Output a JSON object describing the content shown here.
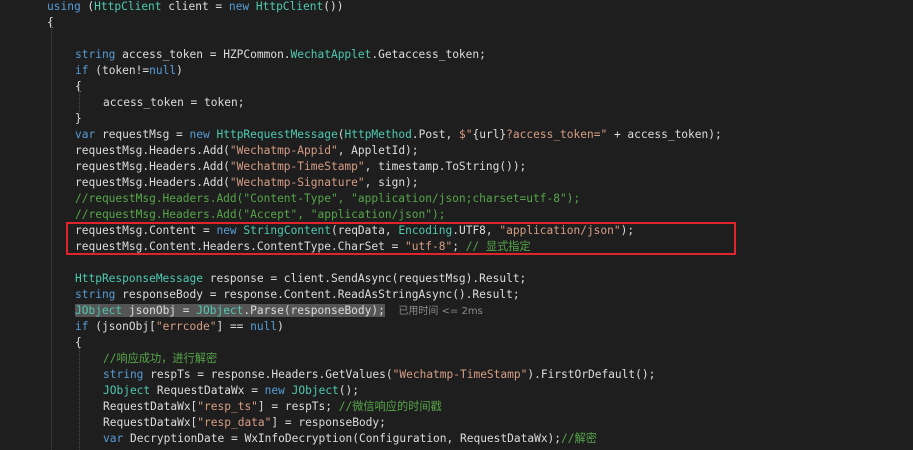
{
  "colors": {
    "background": "#1e1e1e",
    "keyword": "#569cd6",
    "type": "#4ec9b0",
    "string": "#d69d85",
    "comment": "#57a64a",
    "text": "#dcdcdc",
    "highlight_box": "#e0242b"
  },
  "editor": {
    "lines": [
      {
        "indent": 0,
        "tokens": [
          {
            "c": "kw",
            "t": "using"
          },
          {
            "c": "pl",
            "t": " ("
          },
          {
            "c": "ty",
            "t": "HttpClient"
          },
          {
            "c": "pl",
            "t": " client = "
          },
          {
            "c": "kw",
            "t": "new"
          },
          {
            "c": "pl",
            "t": " "
          },
          {
            "c": "ty",
            "t": "HttpClient"
          },
          {
            "c": "pl",
            "t": "())"
          }
        ]
      },
      {
        "indent": 0,
        "tokens": [
          {
            "c": "pl",
            "t": "{"
          }
        ]
      },
      {
        "indent": 1,
        "tokens": []
      },
      {
        "indent": 1,
        "tokens": [
          {
            "c": "kw",
            "t": "string"
          },
          {
            "c": "pl",
            "t": " access_token = HZPCommon."
          },
          {
            "c": "ty",
            "t": "WechatApplet"
          },
          {
            "c": "pl",
            "t": ".Getaccess_token;"
          }
        ]
      },
      {
        "indent": 1,
        "tokens": [
          {
            "c": "kw",
            "t": "if"
          },
          {
            "c": "pl",
            "t": " (token!="
          },
          {
            "c": "kw",
            "t": "null"
          },
          {
            "c": "pl",
            "t": ")"
          }
        ]
      },
      {
        "indent": 1,
        "tokens": [
          {
            "c": "pl",
            "t": "{"
          }
        ]
      },
      {
        "indent": 2,
        "tokens": [
          {
            "c": "pl",
            "t": "access_token = token;"
          }
        ]
      },
      {
        "indent": 1,
        "tokens": [
          {
            "c": "pl",
            "t": "}"
          }
        ]
      },
      {
        "indent": 1,
        "tokens": [
          {
            "c": "kw",
            "t": "var"
          },
          {
            "c": "pl",
            "t": " requestMsg = "
          },
          {
            "c": "kw",
            "t": "new"
          },
          {
            "c": "pl",
            "t": " "
          },
          {
            "c": "ty",
            "t": "HttpRequestMessage"
          },
          {
            "c": "pl",
            "t": "("
          },
          {
            "c": "ty",
            "t": "HttpMethod"
          },
          {
            "c": "pl",
            "t": ".Post, "
          },
          {
            "c": "st",
            "t": "$\""
          },
          {
            "c": "pl",
            "t": "{url}"
          },
          {
            "c": "st",
            "t": "?access_token=\""
          },
          {
            "c": "pl",
            "t": " + access_token);"
          }
        ]
      },
      {
        "indent": 1,
        "tokens": [
          {
            "c": "pl",
            "t": "requestMsg.Headers.Add("
          },
          {
            "c": "st",
            "t": "\"Wechatmp-Appid\""
          },
          {
            "c": "pl",
            "t": ", AppletId);"
          }
        ]
      },
      {
        "indent": 1,
        "tokens": [
          {
            "c": "pl",
            "t": "requestMsg.Headers.Add("
          },
          {
            "c": "st",
            "t": "\"Wechatmp-TimeStamp\""
          },
          {
            "c": "pl",
            "t": ", timestamp.ToString());"
          }
        ]
      },
      {
        "indent": 1,
        "tokens": [
          {
            "c": "pl",
            "t": "requestMsg.Headers.Add("
          },
          {
            "c": "st",
            "t": "\"Wechatmp-Signature\""
          },
          {
            "c": "pl",
            "t": ", sign);"
          }
        ]
      },
      {
        "indent": 1,
        "tokens": [
          {
            "c": "cm",
            "t": "//requestMsg.Headers.Add(\"Content-Type\", \"application/json;charset=utf-8\");"
          }
        ]
      },
      {
        "indent": 1,
        "tokens": [
          {
            "c": "cm",
            "t": "//requestMsg.Headers.Add(\"Accept\", \"application/json\");"
          }
        ]
      },
      {
        "indent": 1,
        "tokens": [
          {
            "c": "pl",
            "t": "requestMsg.Content = "
          },
          {
            "c": "kw",
            "t": "new"
          },
          {
            "c": "pl",
            "t": " "
          },
          {
            "c": "ty",
            "t": "StringContent"
          },
          {
            "c": "pl",
            "t": "(reqData, "
          },
          {
            "c": "ty",
            "t": "Encoding"
          },
          {
            "c": "pl",
            "t": ".UTF8, "
          },
          {
            "c": "st",
            "t": "\"application/json\""
          },
          {
            "c": "pl",
            "t": ");"
          }
        ]
      },
      {
        "indent": 1,
        "tokens": [
          {
            "c": "pl",
            "t": "requestMsg.Content.Headers.ContentType.CharSet = "
          },
          {
            "c": "st",
            "t": "\"utf-8\""
          },
          {
            "c": "pl",
            "t": "; "
          },
          {
            "c": "cm",
            "t": "// 显式指定"
          }
        ]
      },
      {
        "indent": 1,
        "tokens": []
      },
      {
        "indent": 1,
        "tokens": [
          {
            "c": "ty",
            "t": "HttpResponseMessage"
          },
          {
            "c": "pl",
            "t": " response = client.SendAsync(requestMsg).Result;"
          }
        ]
      },
      {
        "indent": 1,
        "tokens": [
          {
            "c": "kw",
            "t": "string"
          },
          {
            "c": "pl",
            "t": " responseBody = response.Content.ReadAsStringAsync().Result;"
          }
        ]
      },
      {
        "indent": 1,
        "tokens": [
          {
            "c": "ty hl",
            "t": "JObject"
          },
          {
            "c": "pl hl",
            "t": " jsonObj = "
          },
          {
            "c": "ty hl",
            "t": "JObject"
          },
          {
            "c": "pl hl",
            "t": ".Parse(responseBody);"
          },
          {
            "c": "pl",
            "t": "  "
          },
          {
            "c": "hint",
            "t": "已用时间 <= 2ms"
          }
        ]
      },
      {
        "indent": 1,
        "tokens": [
          {
            "c": "kw",
            "t": "if"
          },
          {
            "c": "pl",
            "t": " (jsonObj["
          },
          {
            "c": "st",
            "t": "\"errcode\""
          },
          {
            "c": "pl",
            "t": "] == "
          },
          {
            "c": "kw",
            "t": "null"
          },
          {
            "c": "pl",
            "t": ")"
          }
        ]
      },
      {
        "indent": 1,
        "tokens": [
          {
            "c": "pl",
            "t": "{"
          }
        ]
      },
      {
        "indent": 2,
        "tokens": [
          {
            "c": "cm",
            "t": "//响应成功，进行解密"
          }
        ]
      },
      {
        "indent": 2,
        "tokens": [
          {
            "c": "kw",
            "t": "string"
          },
          {
            "c": "pl",
            "t": " respTs = response.Headers.GetValues("
          },
          {
            "c": "st",
            "t": "\"Wechatmp-TimeStamp\""
          },
          {
            "c": "pl",
            "t": ").FirstOrDefault();"
          }
        ]
      },
      {
        "indent": 2,
        "tokens": [
          {
            "c": "ty",
            "t": "JObject"
          },
          {
            "c": "pl",
            "t": " RequestDataWx = "
          },
          {
            "c": "kw",
            "t": "new"
          },
          {
            "c": "pl",
            "t": " "
          },
          {
            "c": "ty",
            "t": "JObject"
          },
          {
            "c": "pl",
            "t": "();"
          }
        ]
      },
      {
        "indent": 2,
        "tokens": [
          {
            "c": "pl",
            "t": "RequestDataWx["
          },
          {
            "c": "st",
            "t": "\"resp_ts\""
          },
          {
            "c": "pl",
            "t": "] = respTs; "
          },
          {
            "c": "cm",
            "t": "//微信响应的时间戳"
          }
        ]
      },
      {
        "indent": 2,
        "tokens": [
          {
            "c": "pl",
            "t": "RequestDataWx["
          },
          {
            "c": "st",
            "t": "\"resp_data\""
          },
          {
            "c": "pl",
            "t": "] = responseBody;"
          }
        ]
      },
      {
        "indent": 2,
        "tokens": [
          {
            "c": "kw",
            "t": "var"
          },
          {
            "c": "pl",
            "t": " DecryptionDate = WxInfoDecryption(Configuration, RequestDataWx);"
          },
          {
            "c": "cm",
            "t": "//解密"
          }
        ]
      }
    ]
  }
}
